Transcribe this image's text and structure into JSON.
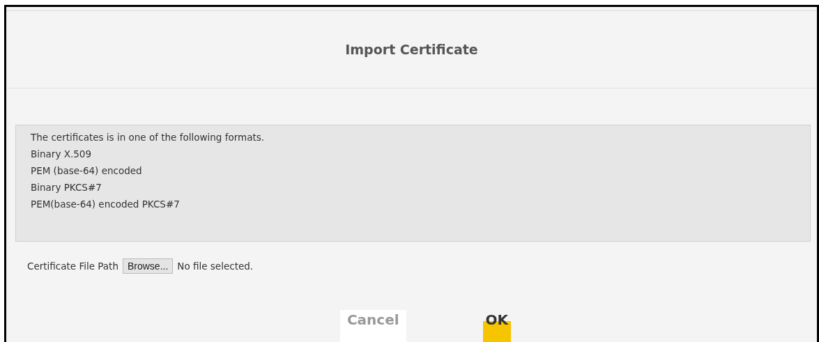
{
  "dialog": {
    "title": "Import Certificate"
  },
  "info": {
    "lines": [
      "The certificates is in one of the following formats.",
      "Binary X.509",
      "PEM (base-64) encoded",
      "Binary PKCS#7",
      "PEM(base-64) encoded PKCS#7"
    ]
  },
  "file_field": {
    "label": "Certificate File Path",
    "button": "Browse...",
    "status": "No file selected."
  },
  "buttons": [
    {
      "label": "Cancel",
      "kind": "secondary"
    },
    {
      "label": "OK",
      "kind": "primary"
    }
  ]
}
